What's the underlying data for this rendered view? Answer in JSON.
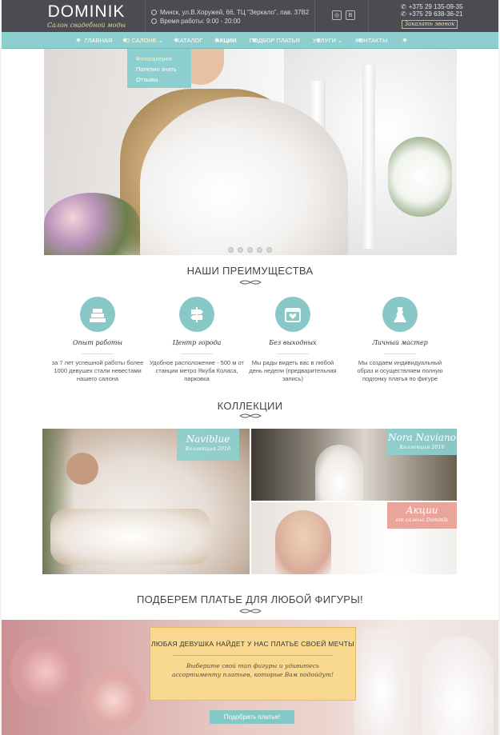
{
  "header": {
    "logo_name": "DOMINIK",
    "logo_tagline": "Салон свадебной моды",
    "address": "Минск, ул.В.Хоружей, 66, ТЦ \"Зеркало\", пав. 37В2",
    "hours": "Время работы: 9:00 - 20:00",
    "phone1": "+375 29 135-09-35",
    "phone2": "+375 29 638-36-21",
    "call_button": "Заказать звонок",
    "social": [
      "instagram-icon",
      "vk-icon"
    ]
  },
  "nav": {
    "items": [
      "ГЛАВНАЯ",
      "О САЛОНЕ",
      "КАТАЛОГ",
      "АКЦИИ",
      "ПОДБОР ПЛАТЬЯ",
      "УСЛУГИ",
      "КОНТАКТЫ"
    ],
    "dropdown": [
      "Фотогалерея",
      "Полезно знать",
      "Отзывы"
    ]
  },
  "advantages": {
    "title": "НАШИ ПРЕИМУЩЕСТВА",
    "items": [
      {
        "icon": "cake-icon",
        "title": "Опыт работы",
        "text": "за 7 лет успешной работы более 1000 девушек стали невестами нашего салона"
      },
      {
        "icon": "signpost-icon",
        "title": "Центр города",
        "text": "Удобное расположение - 500 м от станции метро Якуба Коласа, парковка"
      },
      {
        "icon": "calendar-icon",
        "title": "Без выходных",
        "text": "Мы рады видеть вас в любой день недели (предварительная запись)"
      },
      {
        "icon": "dress-icon",
        "title": "Личный мастер",
        "text": "Мы создаем индивидуальный образ и осуществляем полную подгонку платья по фигуре"
      }
    ]
  },
  "collections": {
    "title": "КОЛЛЕКЦИИ",
    "items": [
      {
        "name": "Naviblue",
        "sub": "Коллекция 2016"
      },
      {
        "name": "Nora Naviano",
        "sub": "Коллекция 2016"
      },
      {
        "name": "Акции",
        "sub": "от салона Dominik"
      }
    ]
  },
  "figure": {
    "title": "ПОДБЕРЕМ ПЛАТЬЕ ДЛЯ ЛЮБОЙ ФИГУРЫ!",
    "box_title": "ЛЮБАЯ ДЕВУШКА НАЙДЕТ У НАС ПЛАТЬЕ СВОЕЙ МЕЧТЫ",
    "box_text": "Выберите свой тип фигуры и удивитесь ассортименту платьев, которые Вам подойдут!",
    "button": "Подобрать платье!"
  },
  "colors": {
    "accent": "#8ccfce",
    "header_bg": "#4b4b52",
    "promo_box": "#f9d990"
  }
}
